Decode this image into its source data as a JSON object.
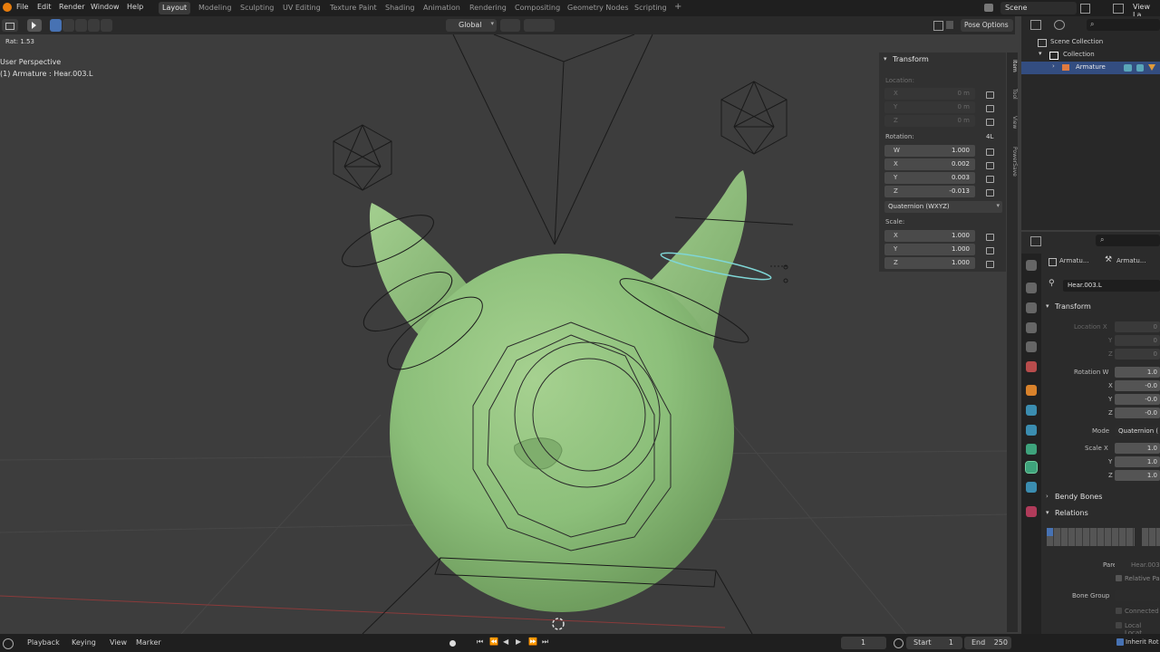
{
  "menubar": {
    "items": [
      "File",
      "Edit",
      "Render",
      "Window",
      "Help"
    ],
    "workspaces": [
      "Layout",
      "Modeling",
      "Sculpting",
      "UV Editing",
      "Texture Paint",
      "Shading",
      "Animation",
      "Rendering",
      "Compositing",
      "Geometry Nodes",
      "Scripting"
    ],
    "active_workspace": "Layout",
    "scene_name": "Scene",
    "view_layer": "View La"
  },
  "viewport_header": {
    "transform_orientation": "Global",
    "pose_options": "Pose Options"
  },
  "viewport": {
    "ratio_text": "Rat: 1.53",
    "perspective": "User Perspective",
    "object_info": "(1) Armature : Hear.003.L"
  },
  "npanel": {
    "title": "Transform",
    "location_label": "Location:",
    "location": [
      {
        "axis": "X",
        "value": "0 m"
      },
      {
        "axis": "Y",
        "value": "0 m"
      },
      {
        "axis": "Z",
        "value": "0 m"
      }
    ],
    "rotation_label": "Rotation:",
    "rotation_mode_badge": "4L",
    "rotation": [
      {
        "axis": "W",
        "value": "1.000"
      },
      {
        "axis": "X",
        "value": "0.002"
      },
      {
        "axis": "Y",
        "value": "0.003"
      },
      {
        "axis": "Z",
        "value": "-0.013"
      }
    ],
    "rotation_mode": "Quaternion (WXYZ)",
    "scale_label": "Scale:",
    "scale": [
      {
        "axis": "X",
        "value": "1.000"
      },
      {
        "axis": "Y",
        "value": "1.000"
      },
      {
        "axis": "Z",
        "value": "1.000"
      }
    ],
    "tabs": [
      "Item",
      "Tool",
      "View",
      "PowerSave"
    ]
  },
  "outliner": {
    "rows": [
      {
        "label": "Scene Collection"
      },
      {
        "label": "Collection"
      },
      {
        "label": "Armature"
      }
    ]
  },
  "properties": {
    "breadcrumb_1": "Armatu...",
    "breadcrumb_2": "Armatu...",
    "bone_name": "Hear.003.L",
    "transform_title": "Transform",
    "location_x_label": "Location X",
    "location_y_label": "Y",
    "location_z_label": "Z",
    "location_values": [
      "0",
      "0",
      "0"
    ],
    "rotation_w_label": "Rotation W",
    "rotation_x_label": "X",
    "rotation_y_label": "Y",
    "rotation_z_label": "Z",
    "rotation_values": [
      "1.0",
      "-0.0",
      "-0.0",
      "-0.0"
    ],
    "mode_label": "Mode",
    "mode_value": "Quaternion (",
    "scale_x_label": "Scale X",
    "scale_y_label": "Y",
    "scale_z_label": "Z",
    "scale_values": [
      "1.0",
      "1.0",
      "1.0"
    ],
    "bendy_bones": "Bendy Bones",
    "relations": "Relations",
    "parent_label": "Parent",
    "parent_value": "Hear.003",
    "relative_parent": "Relative Pa",
    "bone_group_label": "Bone Group",
    "connected": "Connected",
    "local_location": "Local Locat",
    "inherit_rotation": "Inherit Rot"
  },
  "timeline": {
    "menus": [
      "Playback",
      "Keying",
      "View",
      "Marker"
    ],
    "current_frame": "1",
    "start_label": "Start",
    "start_value": "1",
    "end_label": "End",
    "end_value": "250"
  },
  "colors": {
    "accent": "#4772b3",
    "mesh_green": "#8cbf7a",
    "selected_bone": "#7fd6d6",
    "header_bg": "#1f1f1f"
  }
}
